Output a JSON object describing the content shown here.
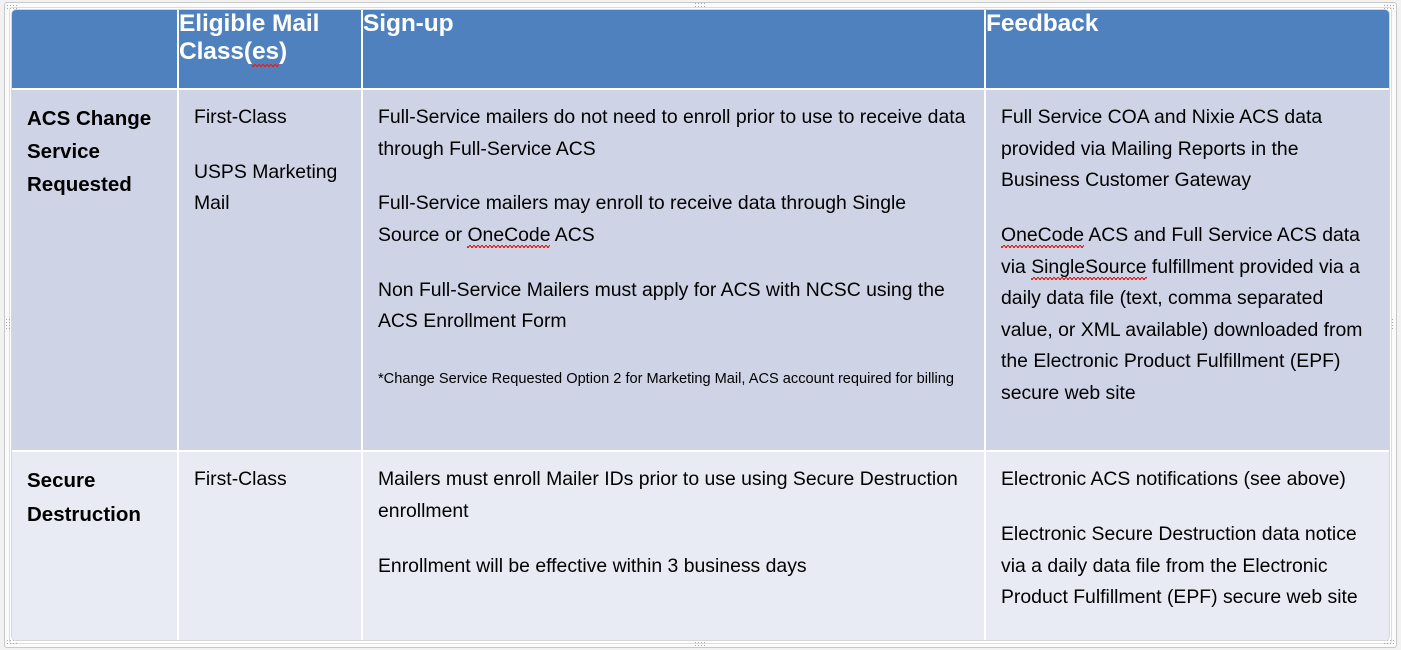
{
  "colors": {
    "header_bg": "#4E81BD",
    "header_text": "#FFFFFF",
    "row1_bg": "#CED4E6",
    "row2_bg": "#E8EBF4",
    "body_text": "#000000",
    "spellcheck_underline": "#E0241B",
    "frame_border": "#C8C8C8"
  },
  "table": {
    "headers": {
      "col_label": "",
      "col_mail_class": "Eligible Mail Class(es)",
      "col_mail_class_line1": "Eligible Mail",
      "col_mail_class_line2a": "Class(",
      "col_mail_class_spell": "es",
      "col_mail_class_line2b": ")",
      "col_signup": "Sign-up",
      "col_feedback": "Feedback"
    },
    "rows": [
      {
        "label": "ACS Change Service Requested",
        "mail_classes": [
          "First-Class",
          "USPS Marketing Mail"
        ],
        "signup_paragraphs": [
          "Full-Service mailers do not need to enroll prior to use to receive data through Full-Service ACS",
          "Full-Service mailers may enroll to receive data through Single Source or OneCode ACS",
          "Non Full-Service Mailers must apply for ACS with NCSC using the ACS Enrollment Form"
        ],
        "signup_p2_before": "Full-Service mailers may enroll to receive data through Single Source or ",
        "signup_p2_spell": "OneCode",
        "signup_p2_after": " ACS",
        "signup_footnote": "*Change Service Requested Option 2 for Marketing Mail, ACS account required for billing",
        "feedback_paragraphs": [
          "Full Service COA and Nixie ACS data provided via Mailing Reports in the Business Customer Gateway",
          "OneCode ACS and Full Service ACS data via SingleSource fulfillment provided via a daily data file (text, comma separated value, or XML available) downloaded from the Electronic Product Fulfillment (EPF) secure web site"
        ],
        "feedback_p2_spell_1": "OneCode",
        "feedback_p2_mid": " ACS and Full Service ACS data via ",
        "feedback_p2_spell_2": "SingleSource",
        "feedback_p2_after": " fulfillment provided via a daily data file (text, comma separated value, or XML available) downloaded from the Electronic Product Fulfillment (EPF) secure web site"
      },
      {
        "label": "Secure Destruction",
        "mail_classes": [
          "First-Class"
        ],
        "signup_paragraphs": [
          "Mailers must enroll Mailer IDs prior to use using Secure Destruction enrollment",
          "Enrollment will be effective within 3 business days"
        ],
        "feedback_paragraphs": [
          "Electronic ACS notifications (see above)",
          "Electronic Secure Destruction data notice via a daily data file from the Electronic Product Fulfillment (EPF) secure web site"
        ]
      }
    ]
  }
}
